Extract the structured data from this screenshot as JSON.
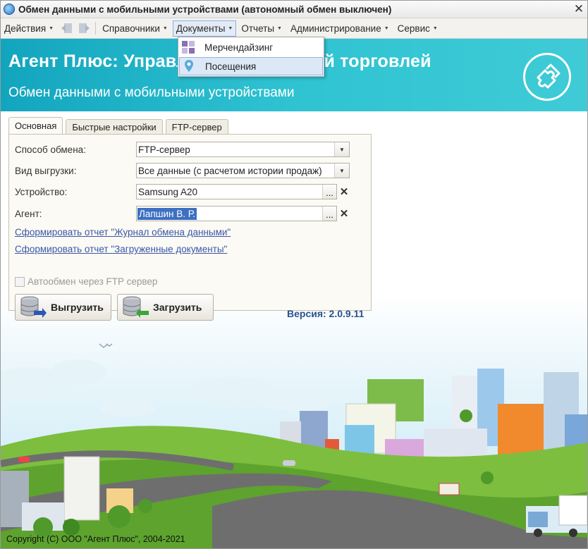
{
  "window": {
    "title": "Обмен данными с мобильными устройствами (автономный обмен выключен)",
    "close_glyph": "✕"
  },
  "menu": {
    "actions": "Действия",
    "references": "Справочники",
    "documents": "Документы",
    "reports": "Отчеты",
    "administration": "Администрирование",
    "service": "Сервис"
  },
  "documents_menu": {
    "items": [
      {
        "label": "Мерчендайзинг",
        "icon": "merchandising-icon"
      },
      {
        "label": "Посещения",
        "icon": "location-pin-icon"
      }
    ]
  },
  "banner": {
    "title": "Агент Плюс: Управление мобильной торговлей",
    "subtitle": "Обмен данными с мобильными устройствами",
    "logo_icon": "puzzle-icon"
  },
  "tabs": [
    "Основная",
    "Быстрые настройки",
    "FTP-сервер"
  ],
  "form": {
    "exchange_method_label": "Способ обмена:",
    "exchange_method_value": "FTP-сервер",
    "upload_type_label": "Вид выгрузки:",
    "upload_type_value": "Все данные (с расчетом истории продаж)",
    "device_label": "Устройство:",
    "device_value": "Samsung A20",
    "agent_label": "Агент:",
    "agent_value": "Лапшин В. Р.",
    "dots_glyph": "...",
    "clear_glyph": "✕"
  },
  "links": {
    "exchange_log": "Сформировать отчет \"Журнал обмена данными\"",
    "loaded_docs": "Сформировать отчет \"Загруженные документы\""
  },
  "autoexchange_label": "Автообмен через FTP сервер",
  "buttons": {
    "upload": "Выгрузить",
    "download": "Загрузить"
  },
  "version": "Версия: 2.0.9.11",
  "copyright": "Copyright (C) ООО \"Агент Плюс\", 2004-2021",
  "colors": {
    "banner": "#2bbccf",
    "link": "#3a57a8",
    "version": "#27528e",
    "selection": "#3d6fc2"
  }
}
